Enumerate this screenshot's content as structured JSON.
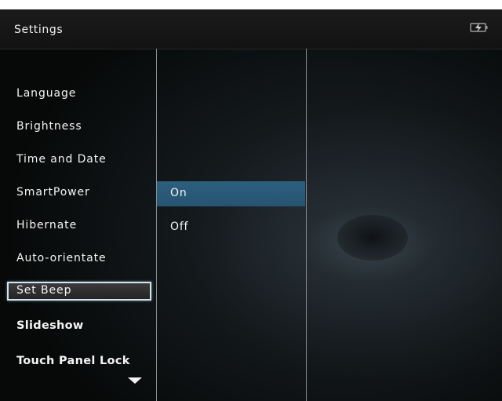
{
  "header": {
    "title": "Settings",
    "status_icon": "battery-charging-icon"
  },
  "menu": {
    "items": [
      {
        "label": "Language"
      },
      {
        "label": "Brightness"
      },
      {
        "label": "Time and Date"
      },
      {
        "label": "SmartPower"
      },
      {
        "label": "Hibernate"
      },
      {
        "label": "Auto-orientate"
      },
      {
        "label": "Set Beep",
        "selected": true
      },
      {
        "label": "Slideshow"
      },
      {
        "label": "Touch Panel Lock"
      }
    ],
    "more_indicator": "down-arrow-icon"
  },
  "options": {
    "items": [
      {
        "label": "On",
        "highlighted": true
      },
      {
        "label": "Off"
      }
    ]
  },
  "colors": {
    "highlight": "#2b5b7a",
    "selection_border": "#cfe3f0",
    "header_bg": "#161616"
  }
}
